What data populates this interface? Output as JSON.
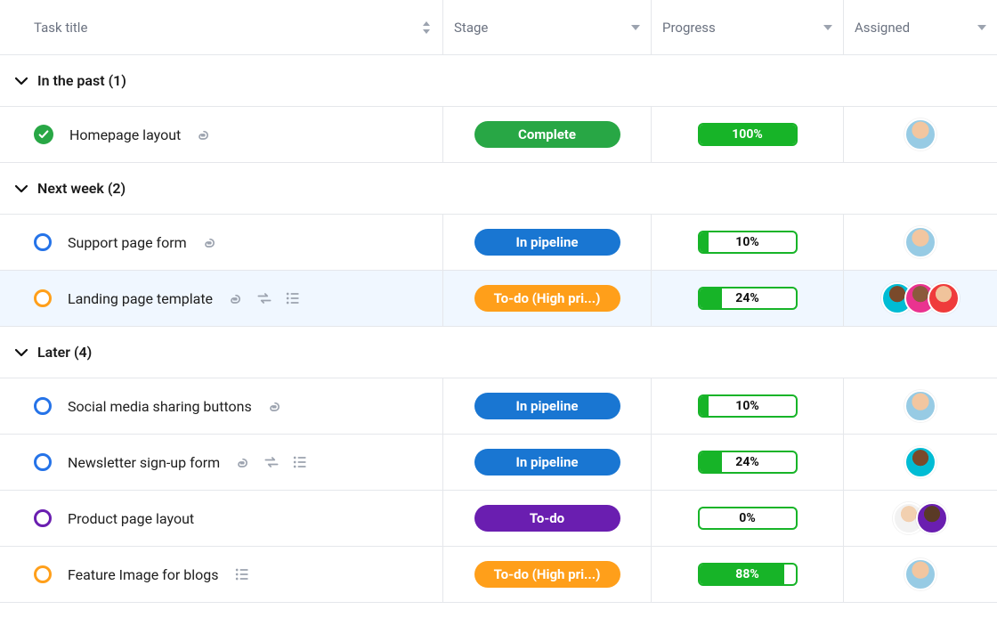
{
  "columns": {
    "title": "Task title",
    "stage": "Stage",
    "progress": "Progress",
    "assigned": "Assigned"
  },
  "groups": [
    {
      "label": "In the past (1)",
      "tasks": [
        {
          "status": "complete",
          "name": "Homepage layout",
          "icons": [
            "attachment"
          ],
          "stage_label": "Complete",
          "stage_color": "green",
          "progress": 100,
          "progress_label": "100%",
          "assignees": [
            "a1"
          ]
        }
      ]
    },
    {
      "label": "Next week (2)",
      "tasks": [
        {
          "status": "blue",
          "name": "Support page form",
          "icons": [
            "attachment"
          ],
          "stage_label": "In pipeline",
          "stage_color": "blue",
          "progress": 10,
          "progress_label": "10%",
          "assignees": [
            "a1"
          ]
        },
        {
          "status": "orange",
          "name": "Landing page template",
          "icons": [
            "attachment",
            "recurring",
            "subtasks"
          ],
          "stage_label": "To-do (High pri...)",
          "stage_color": "orange",
          "progress": 24,
          "progress_label": "24%",
          "assignees": [
            "a2",
            "a3",
            "a4"
          ],
          "selected": true
        }
      ]
    },
    {
      "label": "Later (4)",
      "tasks": [
        {
          "status": "blue",
          "name": "Social media sharing buttons",
          "icons": [
            "attachment"
          ],
          "stage_label": "In pipeline",
          "stage_color": "blue",
          "progress": 10,
          "progress_label": "10%",
          "assignees": [
            "a1"
          ]
        },
        {
          "status": "blue",
          "name": "Newsletter sign-up form",
          "icons": [
            "attachment",
            "recurring",
            "subtasks"
          ],
          "stage_label": "In pipeline",
          "stage_color": "blue",
          "progress": 24,
          "progress_label": "24%",
          "assignees": [
            "a2"
          ]
        },
        {
          "status": "purple",
          "name": "Product page layout",
          "icons": [],
          "stage_label": "To-do",
          "stage_color": "purple",
          "progress": 0,
          "progress_label": "0%",
          "assignees": [
            "a5",
            "a6"
          ]
        },
        {
          "status": "orange",
          "name": "Feature Image for blogs",
          "icons": [
            "subtasks"
          ],
          "stage_label": "To-do (High pri...)",
          "stage_color": "orange",
          "progress": 88,
          "progress_label": "88%",
          "assignees": [
            "a1"
          ]
        }
      ]
    }
  ]
}
